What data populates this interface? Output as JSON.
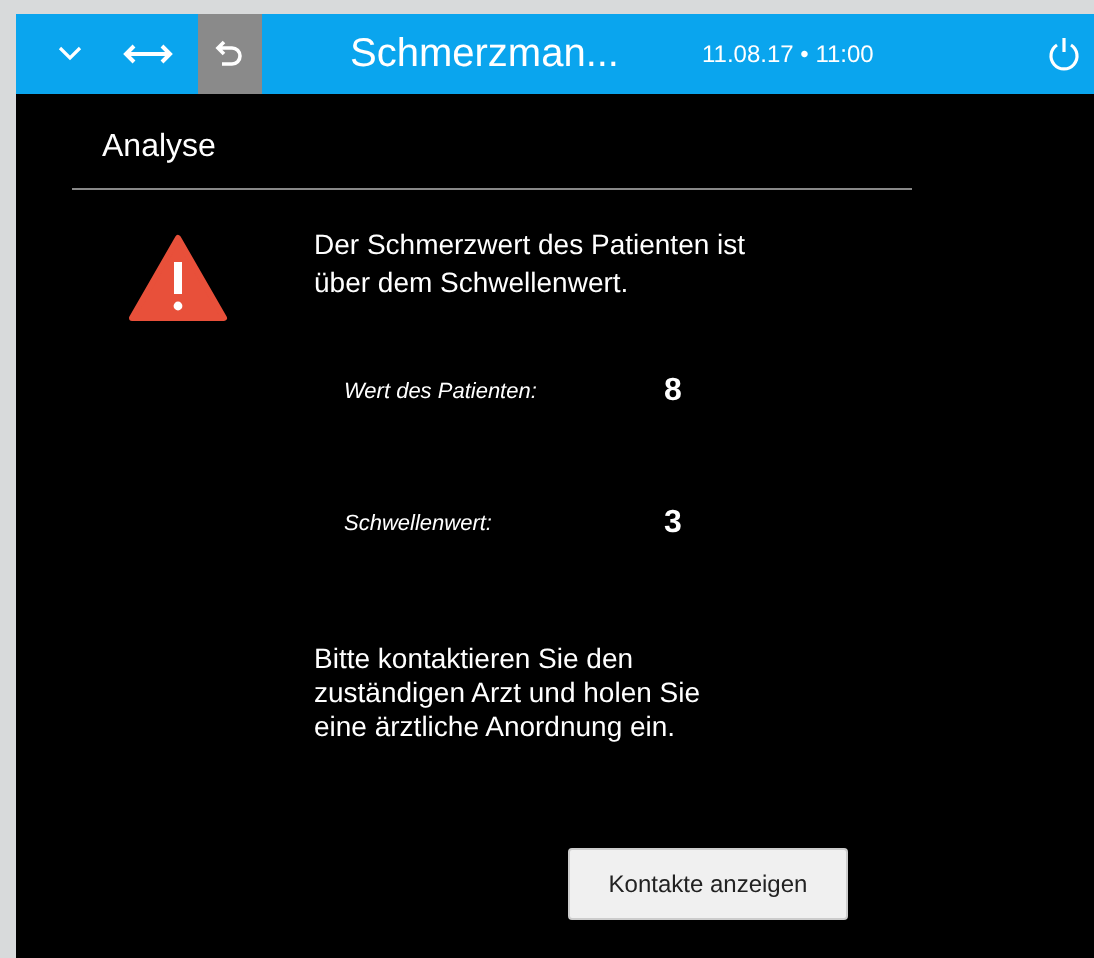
{
  "header": {
    "title": "Schmerzman...",
    "datetime": "11.08.17 • 11:00"
  },
  "section": {
    "title": "Analyse"
  },
  "alert": {
    "message": "Der Schmerzwert des Patienten ist über dem Schwellenwert."
  },
  "values": [
    {
      "label": "Wert des Patienten:",
      "value": "8"
    },
    {
      "label": "Schwellenwert:",
      "value": "3"
    }
  ],
  "instruction": "Bitte kontaktieren Sie den zuständigen Arzt und holen Sie eine ärztliche Anordnung ein.",
  "button": "Kontakte anzeigen"
}
